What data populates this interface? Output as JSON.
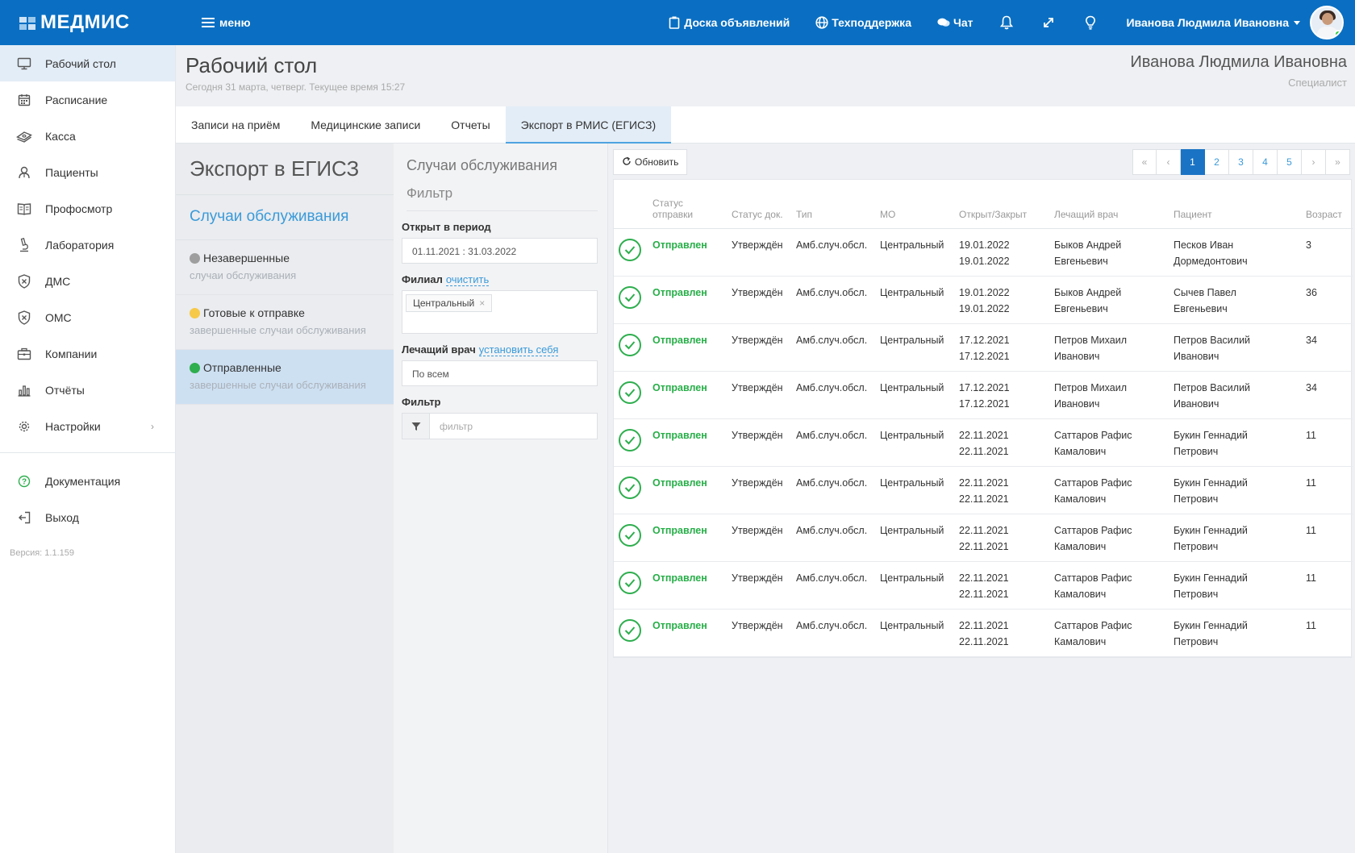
{
  "app": {
    "logo": "МЕДМИС",
    "menu_label": "меню",
    "links": {
      "board": "Доска объявлений",
      "support": "Техподдержка",
      "chat": "Чат"
    },
    "user_name": "Иванова Людмила Ивановна"
  },
  "sidebar": {
    "items": [
      {
        "label": "Рабочий стол",
        "icon": "monitor-icon"
      },
      {
        "label": "Расписание",
        "icon": "calendar-icon"
      },
      {
        "label": "Касса",
        "icon": "cash-icon"
      },
      {
        "label": "Пациенты",
        "icon": "patients-icon"
      },
      {
        "label": "Профосмотр",
        "icon": "book-icon"
      },
      {
        "label": "Лаборатория",
        "icon": "microscope-icon"
      },
      {
        "label": "ДМС",
        "icon": "shield-icon"
      },
      {
        "label": "ОМС",
        "icon": "shield-icon"
      },
      {
        "label": "Компании",
        "icon": "briefcase-icon"
      },
      {
        "label": "Отчёты",
        "icon": "chart-icon"
      },
      {
        "label": "Настройки",
        "icon": "gear-icon"
      }
    ],
    "docs": "Документация",
    "exit": "Выход",
    "version": "Версия: 1.1.159"
  },
  "header": {
    "title": "Рабочий стол",
    "subtitle": "Сегодня 31 марта, четверг. Текущее время 15:27",
    "user": "Иванова Людмила Ивановна",
    "role": "Специалист"
  },
  "tabs": [
    "Записи на приём",
    "Медицинские записи",
    "Отчеты",
    "Экспорт в РМИС (ЕГИСЗ)"
  ],
  "categories": {
    "title": "Экспорт в ЕГИСЗ",
    "subtitle": "Случаи обслуживания",
    "items": [
      {
        "label": "Незавершенные",
        "desc": "случаи обслуживания",
        "color": "#9e9e9e"
      },
      {
        "label": "Готовые к отправке",
        "desc": "завершенные случаи обслуживания",
        "color": "#f7c948"
      },
      {
        "label": "Отправленные",
        "desc": "завершенные случаи обслуживания",
        "color": "#2eae4e"
      }
    ]
  },
  "filter": {
    "title": "Случаи обслуживания",
    "filter_heading": "Фильтр",
    "period_label": "Открыт в период",
    "period_value": "01.11.2021  :  31.03.2022",
    "branch_label": "Филиал",
    "branch_clear": "очистить",
    "branch_chip": "Центральный",
    "doctor_label": "Лечащий врач",
    "doctor_set_self": "установить себя",
    "doctor_value": "По всем",
    "search_label": "Фильтр",
    "search_placeholder": "фильтр"
  },
  "toolbar": {
    "refresh": "Обновить",
    "pages": [
      "«",
      "‹",
      "1",
      "2",
      "3",
      "4",
      "5",
      "›",
      "»"
    ],
    "active_page": "1"
  },
  "table": {
    "headers": {
      "status": "Статус отправки",
      "doc_status": "Статус док.",
      "type": "Тип",
      "mo": "МО",
      "dates": "Открыт/Закрыт",
      "doctor": "Лечащий врач",
      "patient": "Пациент",
      "age": "Возраст"
    },
    "rows": [
      {
        "status": "Отправлен",
        "doc": "Утверждён",
        "type": "Амб.случ.обсл.",
        "mo": "Центральный",
        "open": "19.01.2022",
        "close": "19.01.2022",
        "doctor1": "Быков Андрей",
        "doctor2": "Евгеньевич",
        "patient1": "Песков Иван",
        "patient2": "Дормедонтович",
        "age": "3"
      },
      {
        "status": "Отправлен",
        "doc": "Утверждён",
        "type": "Амб.случ.обсл.",
        "mo": "Центральный",
        "open": "19.01.2022",
        "close": "19.01.2022",
        "doctor1": "Быков Андрей",
        "doctor2": "Евгеньевич",
        "patient1": "Сычев Павел",
        "patient2": "Евгеньевич",
        "age": "36"
      },
      {
        "status": "Отправлен",
        "doc": "Утверждён",
        "type": "Амб.случ.обсл.",
        "mo": "Центральный",
        "open": "17.12.2021",
        "close": "17.12.2021",
        "doctor1": "Петров Михаил",
        "doctor2": "Иванович",
        "patient1": "Петров Василий",
        "patient2": "Иванович",
        "age": "34"
      },
      {
        "status": "Отправлен",
        "doc": "Утверждён",
        "type": "Амб.случ.обсл.",
        "mo": "Центральный",
        "open": "17.12.2021",
        "close": "17.12.2021",
        "doctor1": "Петров Михаил",
        "doctor2": "Иванович",
        "patient1": "Петров Василий",
        "patient2": "Иванович",
        "age": "34"
      },
      {
        "status": "Отправлен",
        "doc": "Утверждён",
        "type": "Амб.случ.обсл.",
        "mo": "Центральный",
        "open": "22.11.2021",
        "close": "22.11.2021",
        "doctor1": "Саттаров Рафис",
        "doctor2": "Камалович",
        "patient1": "Букин Геннадий",
        "patient2": "Петрович",
        "age": "11"
      },
      {
        "status": "Отправлен",
        "doc": "Утверждён",
        "type": "Амб.случ.обсл.",
        "mo": "Центральный",
        "open": "22.11.2021",
        "close": "22.11.2021",
        "doctor1": "Саттаров Рафис",
        "doctor2": "Камалович",
        "patient1": "Букин Геннадий",
        "patient2": "Петрович",
        "age": "11"
      },
      {
        "status": "Отправлен",
        "doc": "Утверждён",
        "type": "Амб.случ.обсл.",
        "mo": "Центральный",
        "open": "22.11.2021",
        "close": "22.11.2021",
        "doctor1": "Саттаров Рафис",
        "doctor2": "Камалович",
        "patient1": "Букин Геннадий",
        "patient2": "Петрович",
        "age": "11"
      },
      {
        "status": "Отправлен",
        "doc": "Утверждён",
        "type": "Амб.случ.обсл.",
        "mo": "Центральный",
        "open": "22.11.2021",
        "close": "22.11.2021",
        "doctor1": "Саттаров Рафис",
        "doctor2": "Камалович",
        "patient1": "Букин Геннадий",
        "patient2": "Петрович",
        "age": "11"
      },
      {
        "status": "Отправлен",
        "doc": "Утверждён",
        "type": "Амб.случ.обсл.",
        "mo": "Центральный",
        "open": "22.11.2021",
        "close": "22.11.2021",
        "doctor1": "Саттаров Рафис",
        "doctor2": "Камалович",
        "patient1": "Букин Геннадий",
        "patient2": "Петрович",
        "age": "11"
      }
    ]
  },
  "colors": {
    "brand": "#0a6fc2",
    "sent": "#27ae48",
    "link": "#3a9ad9"
  }
}
